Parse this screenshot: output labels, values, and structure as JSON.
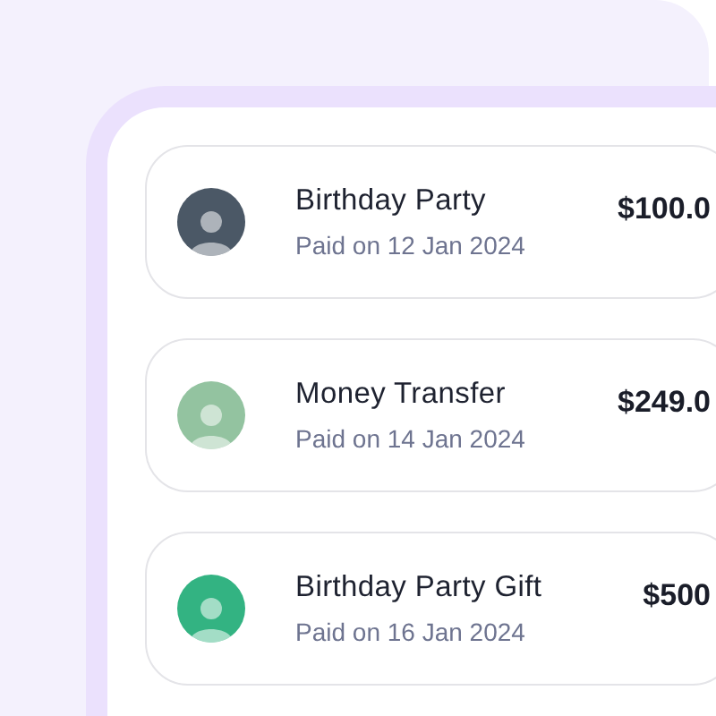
{
  "payments": [
    {
      "title": "Birthday Party",
      "subtitle": "Paid on 12 Jan 2024",
      "amount": "$100.0",
      "avatar": {
        "color": "#4b5866"
      }
    },
    {
      "title": "Money Transfer",
      "subtitle": "Paid on 14 Jan 2024",
      "amount": "$249.0",
      "avatar": {
        "color": "#93c3a0"
      }
    },
    {
      "title": "Birthday Party Gift",
      "subtitle": "Paid on 16 Jan 2024",
      "amount": "$500",
      "avatar": {
        "color": "#33b382"
      }
    }
  ]
}
